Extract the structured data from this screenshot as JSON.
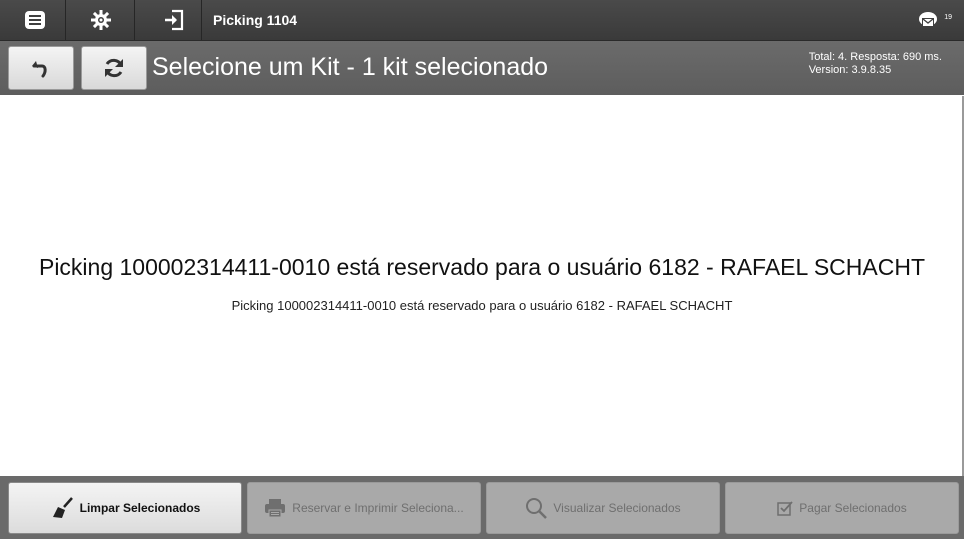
{
  "topbar": {
    "title": "Picking 1104",
    "menu_icon": "menu-icon",
    "settings_icon": "gear-icon",
    "login_icon": "sign-in-icon",
    "messages_icon": "envelope-icon",
    "messages_count": "19"
  },
  "header": {
    "back_icon": "undo-icon",
    "refresh_icon": "refresh-icon",
    "title": "Selecione um Kit - 1 kit selecionado",
    "total_line": "Total: 4. Resposta: 690 ms.",
    "version_line": "Version: 3.9.8.35"
  },
  "main": {
    "message": "Picking 100002314411-0010 está reservado para o usuário 6182 - RAFAEL SCHACHT",
    "submessage": "Picking 100002314411-0010 está reservado para o usuário 6182 - RAFAEL SCHACHT"
  },
  "actions": {
    "clear": {
      "label": "Limpar Selecionados",
      "icon": "broom-icon",
      "enabled": true
    },
    "reserve_print": {
      "label": "Reservar e Imprimir Seleciona...",
      "icon": "printer-icon",
      "enabled": false
    },
    "view": {
      "label": "Visualizar Selecionados",
      "icon": "search-icon",
      "enabled": false
    },
    "pay": {
      "label": "Pagar Selecionados",
      "icon": "checkbox-icon",
      "enabled": false
    }
  },
  "colors": {
    "topbar": "#3f3f3f",
    "header": "#646464",
    "bottombar": "#6a6a6a",
    "button_active": "#e8e8e8",
    "button_disabled": "#a9a9a9"
  }
}
